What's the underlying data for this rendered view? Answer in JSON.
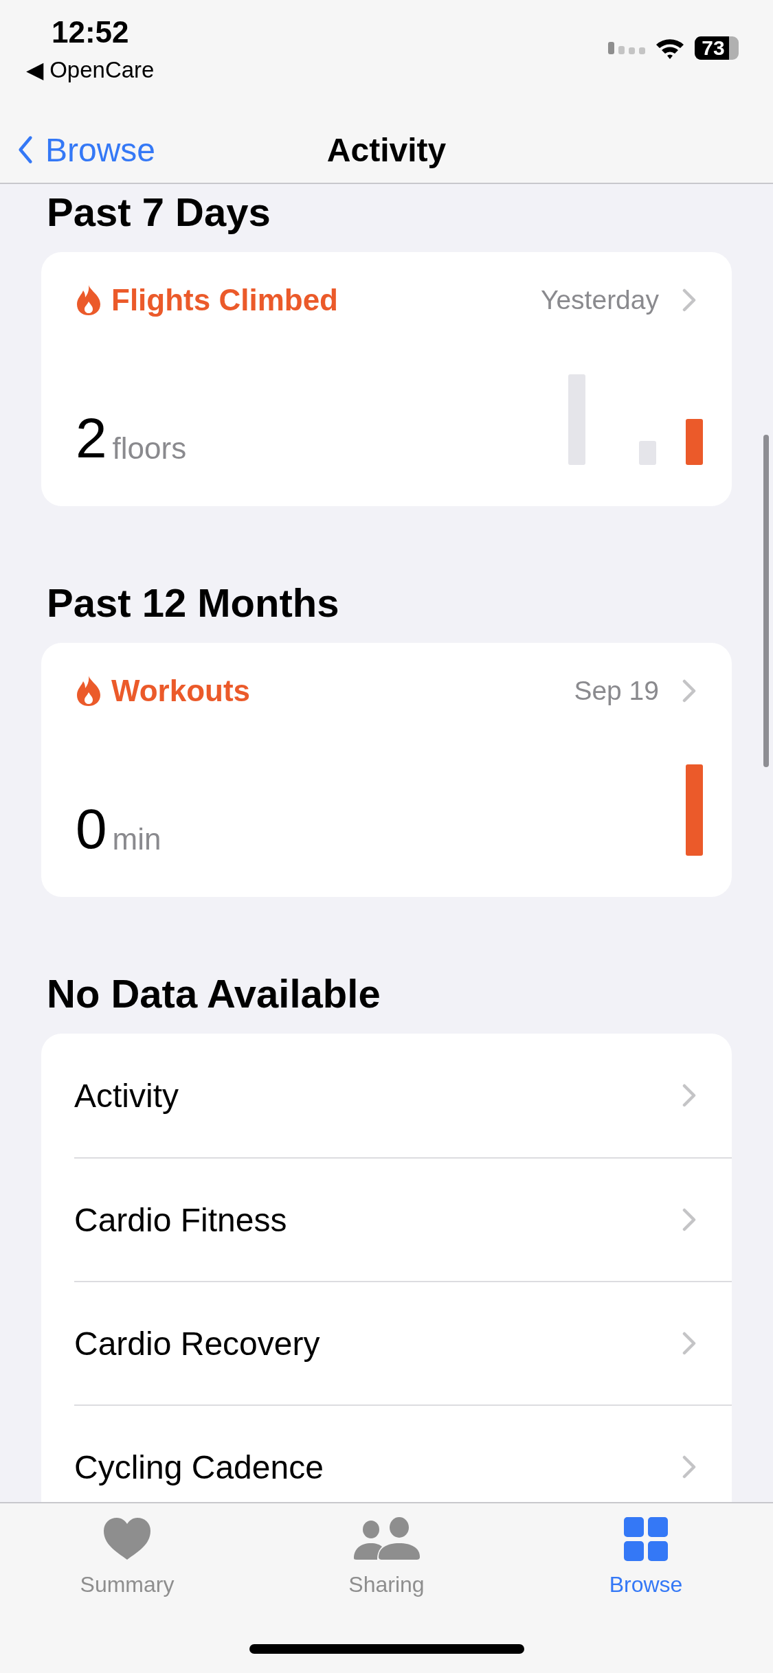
{
  "status_bar": {
    "time": "12:52",
    "back_app": "◀ OpenCare",
    "battery": "73"
  },
  "nav": {
    "back": "Browse",
    "title": "Activity"
  },
  "sections": [
    {
      "heading": "Past 7 Days",
      "card": {
        "title": "Flights Climbed",
        "date": "Yesterday",
        "value": "2",
        "unit": "floors"
      }
    },
    {
      "heading": "Past 12 Months",
      "card": {
        "title": "Workouts",
        "date": "Sep 19",
        "value": "0",
        "unit": "min"
      }
    }
  ],
  "no_data": {
    "heading": "No Data Available",
    "items": [
      "Activity",
      "Cardio Fitness",
      "Cardio Recovery",
      "Cycling Cadence"
    ]
  },
  "tabs": [
    {
      "label": "Summary",
      "selected": false
    },
    {
      "label": "Sharing",
      "selected": false
    },
    {
      "label": "Browse",
      "selected": true
    }
  ]
}
